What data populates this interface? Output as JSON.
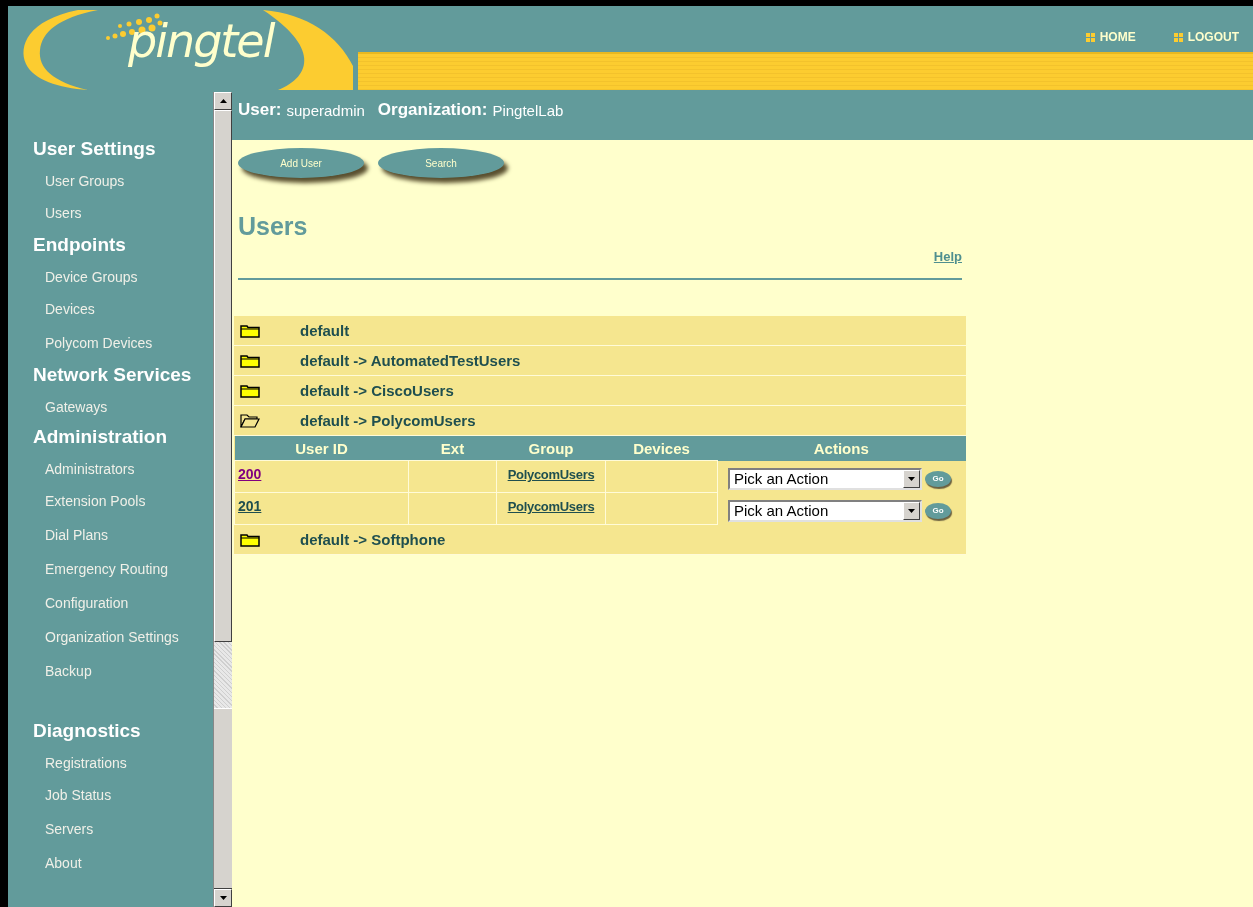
{
  "header": {
    "logo": "pingtel",
    "nav": [
      "HOME",
      "LOGOUT"
    ]
  },
  "sidebar": [
    {
      "heading": "User Settings",
      "items": [
        "User Groups",
        "Users"
      ]
    },
    {
      "heading": "Endpoints",
      "items": [
        "Device Groups",
        "Devices",
        "Polycom Devices"
      ]
    },
    {
      "heading": "Network Services",
      "items": [
        "Gateways"
      ]
    },
    {
      "heading": "Administration",
      "items": [
        "Administrators",
        "Extension Pools",
        "Dial Plans",
        "Emergency Routing",
        "Configuration",
        "Organization Settings",
        "Backup"
      ]
    },
    {
      "heading": "Diagnostics",
      "items": [
        "Registrations",
        "Job Status",
        "Servers",
        "About"
      ]
    }
  ],
  "user_bar": {
    "user_label": "User:",
    "user": "superadmin",
    "org_label": "Organization:",
    "org": "PingtelLab"
  },
  "buttons": [
    "Add User",
    "Search"
  ],
  "page_title": "Users",
  "help": "Help",
  "groups": [
    {
      "label": "default",
      "expanded": false
    },
    {
      "label": "default -> AutomatedTestUsers",
      "expanded": false
    },
    {
      "label": "default -> CiscoUsers",
      "expanded": false
    },
    {
      "label": "default -> PolycomUsers",
      "expanded": true,
      "table": {
        "columns": [
          "User ID",
          "Ext",
          "Group",
          "Devices",
          "Actions"
        ],
        "rows": [
          {
            "user_id": "200",
            "visited": true,
            "group": "PolycomUsers",
            "action": "Pick an Action",
            "go": "Go"
          },
          {
            "user_id": "201",
            "visited": false,
            "group": "PolycomUsers",
            "action": "Pick an Action",
            "go": "Go"
          }
        ]
      }
    },
    {
      "label": "default -> Softphone",
      "expanded": false
    }
  ]
}
